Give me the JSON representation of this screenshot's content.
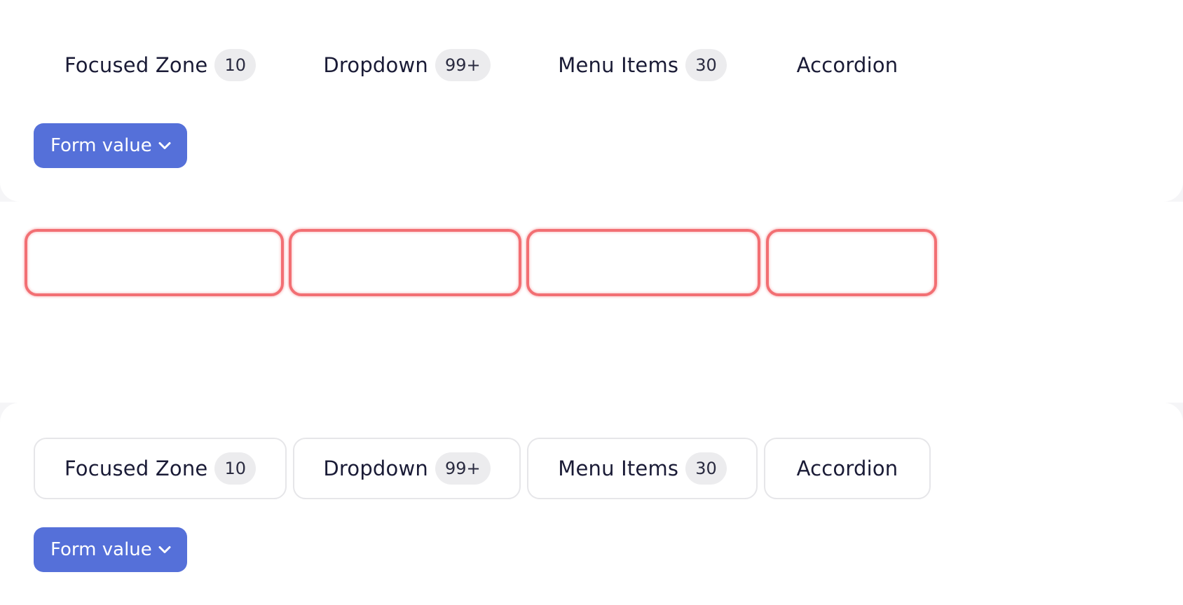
{
  "top_panel": {
    "tabs": [
      {
        "label": "Focused Zone",
        "badge": "10"
      },
      {
        "label": "Dropdown",
        "badge": "99+"
      },
      {
        "label": "Menu Items",
        "badge": "30"
      },
      {
        "label": "Accordion"
      }
    ],
    "form_button": {
      "label": "Form value",
      "icon": "chevron-down-icon"
    }
  },
  "bottom_panel": {
    "tabs": [
      {
        "label": "Focused Zone",
        "badge": "10"
      },
      {
        "label": "Dropdown",
        "badge": "99+"
      },
      {
        "label": "Menu Items",
        "badge": "30"
      },
      {
        "label": "Accordion"
      }
    ],
    "form_button": {
      "label": "Form value",
      "icon": "chevron-down-icon"
    }
  },
  "colors": {
    "accent": "#5570d9",
    "focus_outline": "#f26f73",
    "badge_bg": "#ececee",
    "text": "#1a1b36",
    "tab_border": "#e6e6e9"
  }
}
